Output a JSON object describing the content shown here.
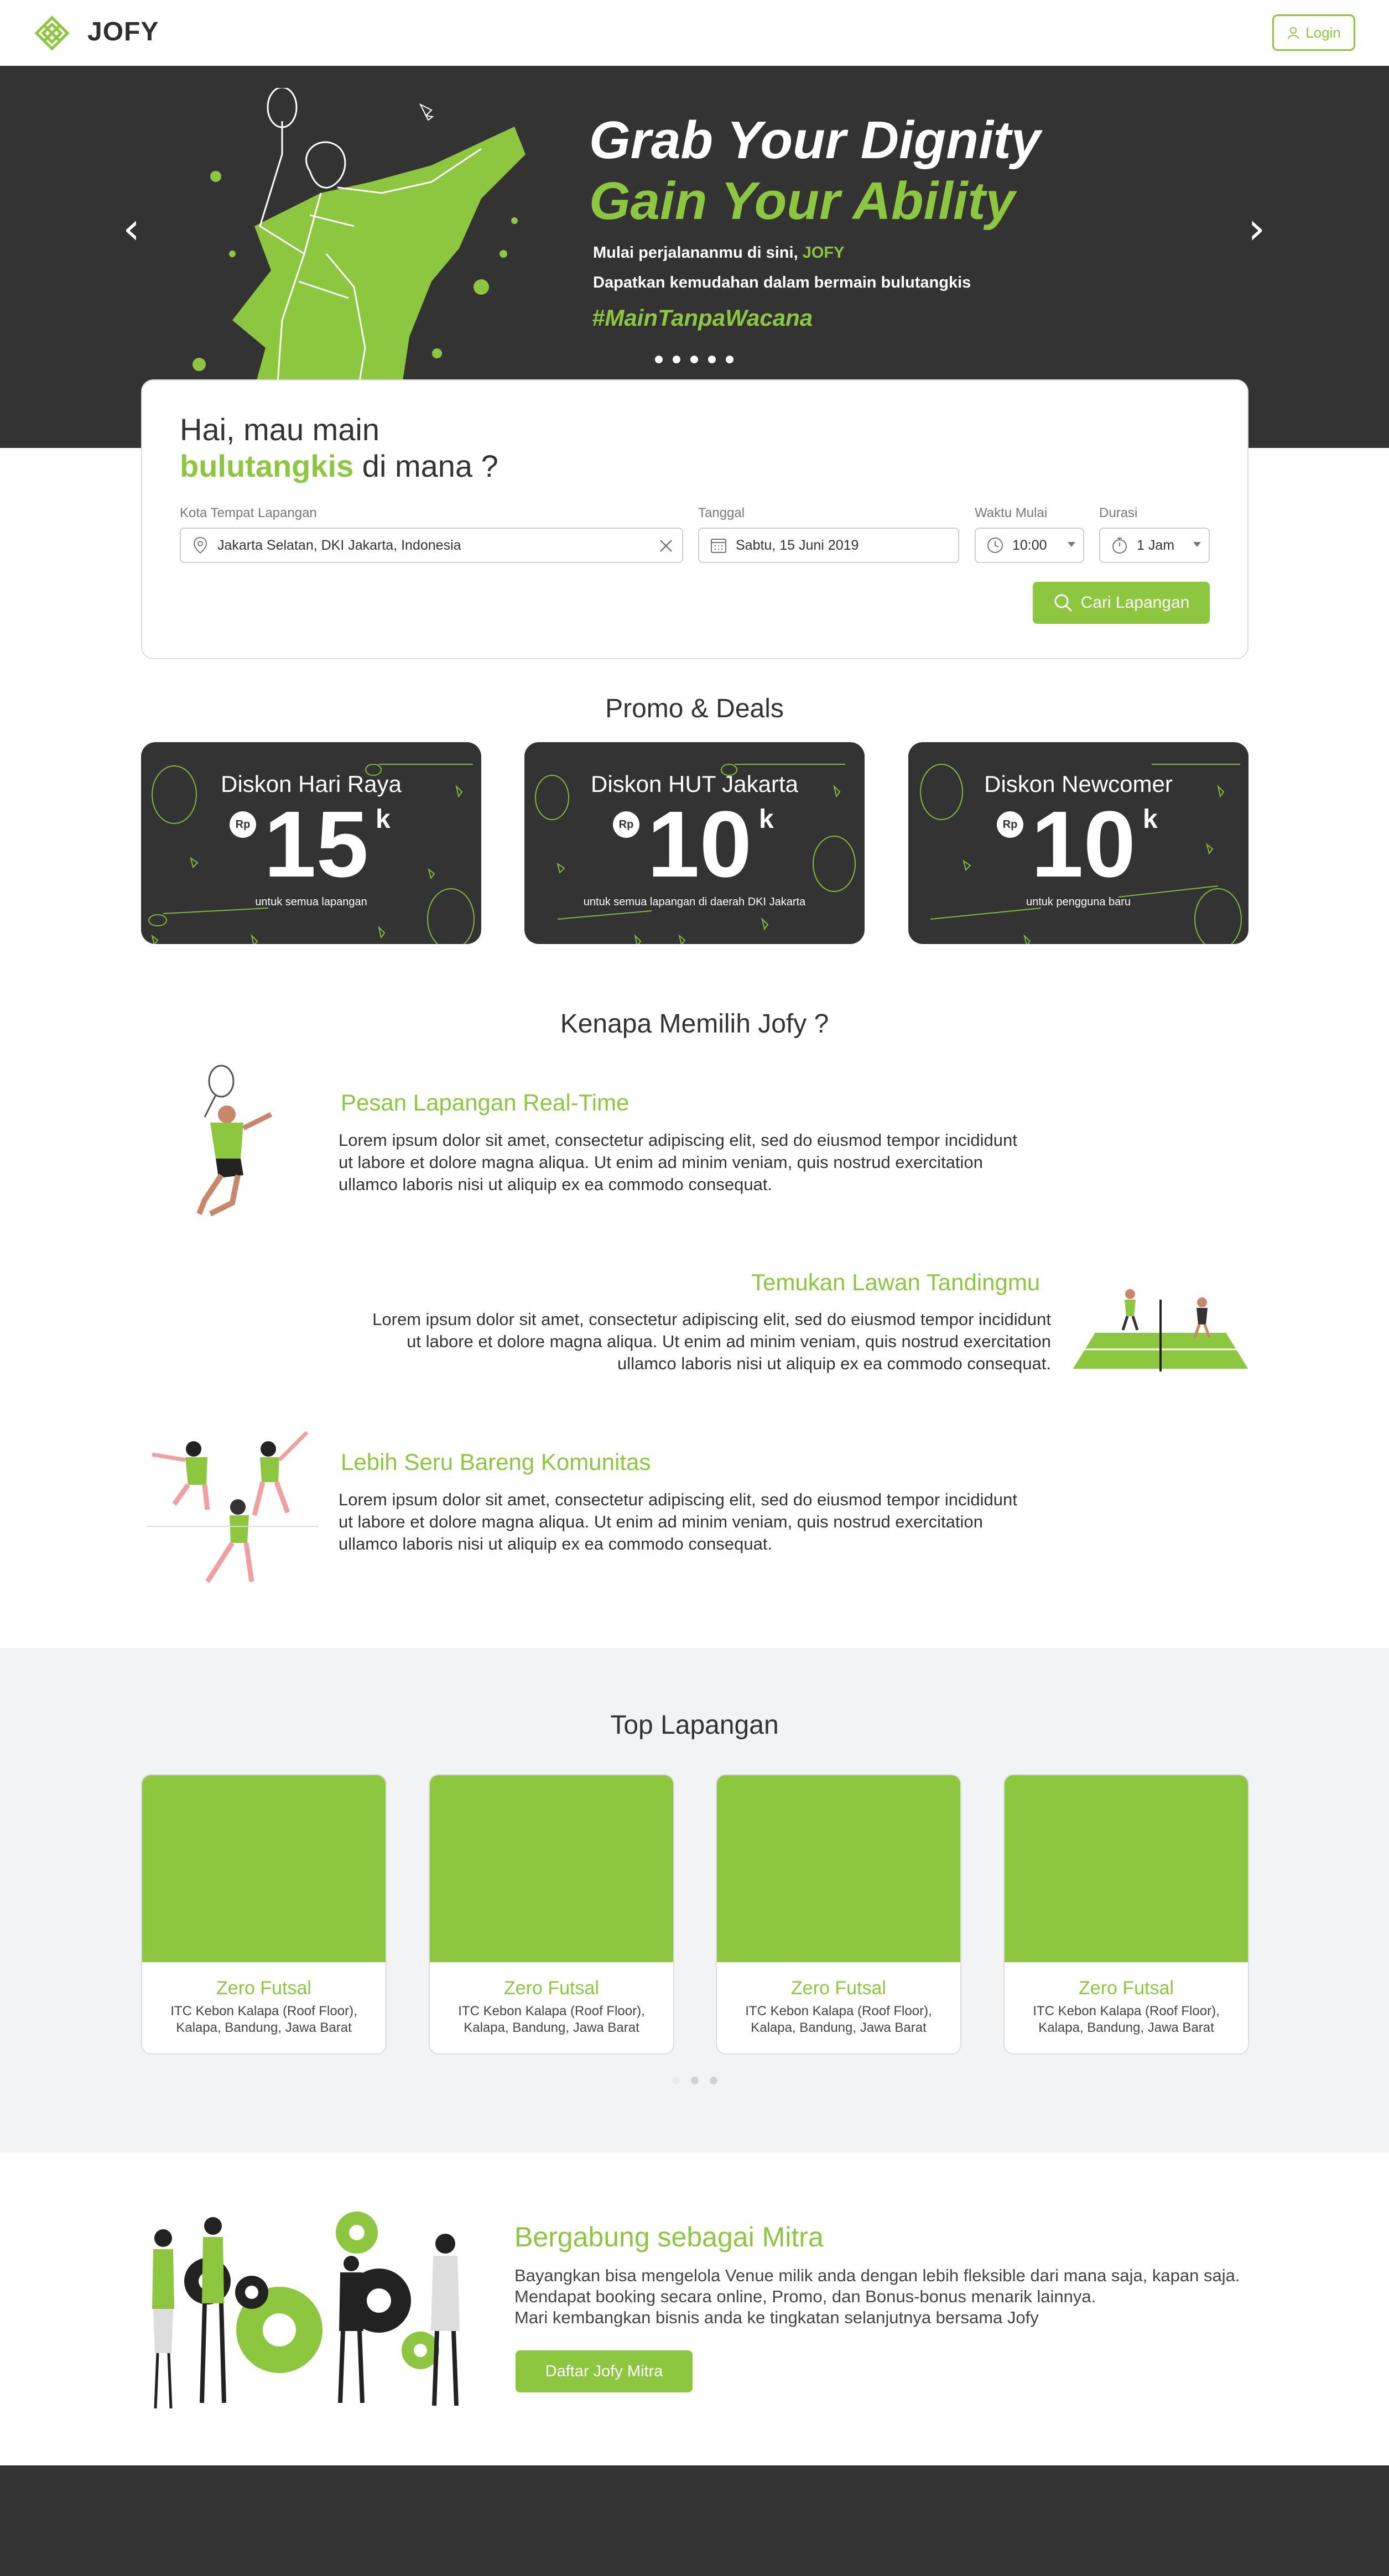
{
  "brand": {
    "name": "JOFY",
    "accent": "#8dc63f",
    "dark": "#333333"
  },
  "nav": {
    "login_label": "Login"
  },
  "hero": {
    "title_line1": "Grab Your Dignity",
    "title_line2": "Gain Your Ability",
    "line1_prefix": "Mulai perjalananmu di sini,",
    "line1_brand": "JOFY",
    "line2": "Dapatkan kemudahan dalam bermain bulutangkis",
    "tagline": "#MainTanpaWacana",
    "slide_count": 5
  },
  "search": {
    "heading_line1": "Hai, mau main",
    "heading_sport": "bulutangkis",
    "heading_rest": "di mana ?",
    "city_label": "Kota Tempat Lapangan",
    "city_value": "Jakarta Selatan, DKI Jakarta, Indonesia",
    "date_label": "Tanggal",
    "date_value": "Sabtu, 15 Juni 2019",
    "time_label": "Waktu Mulai",
    "time_value": "10:00",
    "duration_label": "Durasi",
    "duration_value": "1 Jam",
    "submit_label": "Cari Lapangan"
  },
  "promo": {
    "title": "Promo & Deals",
    "cards": [
      {
        "title": "Diskon Hari Raya",
        "currency": "Rp",
        "amount": "15",
        "unit": "k",
        "note": "untuk semua lapangan"
      },
      {
        "title": "Diskon HUT Jakarta",
        "currency": "Rp",
        "amount": "10",
        "unit": "k",
        "note": "untuk semua lapangan di daerah DKI Jakarta"
      },
      {
        "title": "Diskon Newcomer",
        "currency": "Rp",
        "amount": "10",
        "unit": "k",
        "note": "untuk pengguna baru"
      }
    ]
  },
  "why": {
    "title": "Kenapa Memilih Jofy ?",
    "items": [
      {
        "title": "Pesan Lapangan Real-Time",
        "line1": "Lorem ipsum dolor sit amet, consectetur adipiscing elit, sed do eiusmod tempor incididunt",
        "line2": "ut labore et dolore magna aliqua. Ut enim ad minim veniam, quis nostrud exercitation",
        "line3": "ullamco laboris nisi ut aliquip ex ea commodo consequat."
      },
      {
        "title": "Temukan Lawan Tandingmu",
        "line1": "Lorem ipsum dolor sit amet, consectetur adipiscing elit, sed do eiusmod tempor incididunt",
        "line2": "ut labore et dolore magna aliqua. Ut enim ad minim veniam, quis nostrud exercitation",
        "line3": "ullamco laboris nisi ut aliquip ex ea commodo consequat."
      },
      {
        "title": "Lebih Seru Bareng Komunitas",
        "line1": "Lorem ipsum dolor sit amet, consectetur adipiscing elit, sed do eiusmod tempor incididunt",
        "line2": "ut labore et dolore magna aliqua. Ut enim ad minim veniam, quis nostrud exercitation",
        "line3": "ullamco laboris nisi ut aliquip ex ea commodo consequat."
      }
    ]
  },
  "top": {
    "title": "Top Lapangan",
    "venues": [
      {
        "name": "Zero Futsal",
        "addr1": "ITC Kebon Kalapa (Roof Floor),",
        "addr2": "Kalapa, Bandung, Jawa Barat"
      },
      {
        "name": "Zero Futsal",
        "addr1": "ITC Kebon Kalapa (Roof Floor),",
        "addr2": "Kalapa, Bandung, Jawa Barat"
      },
      {
        "name": "Zero Futsal",
        "addr1": "ITC Kebon Kalapa (Roof Floor),",
        "addr2": "Kalapa, Bandung, Jawa Barat"
      },
      {
        "name": "Zero Futsal",
        "addr1": "ITC Kebon Kalapa (Roof Floor),",
        "addr2": "Kalapa, Bandung, Jawa Barat"
      }
    ],
    "page_count": 3
  },
  "mitra": {
    "title": "Bergabung sebagai Mitra",
    "line1": "Bayangkan bisa mengelola Venue milik anda dengan lebih fleksible dari mana saja, kapan saja.",
    "line2": "Mendapat booking secara online, Promo, dan Bonus-bonus menarik lainnya.",
    "line3": "Mari kembangkan bisnis anda ke tingkatan selanjutnya bersama Jofy",
    "button_label": "Daftar Jofy Mitra"
  }
}
